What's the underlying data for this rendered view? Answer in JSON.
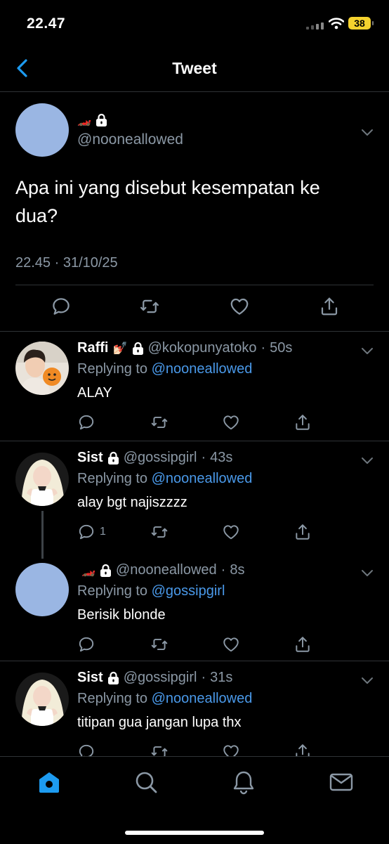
{
  "status": {
    "time": "22.47",
    "battery": "38"
  },
  "nav": {
    "title": "Tweet"
  },
  "main_tweet": {
    "handle": "@nooneallowed",
    "text": "Apa ini yang disebut kesempatan ke dua?",
    "timestamp": "22.45 · 31/10/25"
  },
  "replies": [
    {
      "name": "Raffi",
      "handle": "@kokopunyatoko",
      "time": "50s",
      "replying_prefix": "Replying to ",
      "replying_to": "@nooneallowed",
      "text": "ALAY",
      "reply_count": ""
    },
    {
      "name": "Sist",
      "handle": "@gossipgirl",
      "time": "43s",
      "replying_prefix": "Replying to ",
      "replying_to": "@nooneallowed",
      "text": "alay bgt najiszzzz",
      "reply_count": "1"
    },
    {
      "name": "",
      "handle": "@nooneallowed",
      "time": "8s",
      "replying_prefix": "Replying to ",
      "replying_to": "@gossipgirl",
      "text": "Berisik blonde",
      "reply_count": ""
    },
    {
      "name": "Sist",
      "handle": "@gossipgirl",
      "time": "31s",
      "replying_prefix": "Replying to ",
      "replying_to": "@nooneallowed",
      "text": "titipan gua jangan lupa thx",
      "reply_count": ""
    }
  ],
  "colors": {
    "accent": "#1d9bf0",
    "mention": "#4a99e9",
    "muted": "#8b98a5",
    "divider": "#2f3336",
    "battery": "#f5d22e"
  },
  "icons": [
    "back-chevron-icon",
    "lock-icon",
    "chevron-down-icon",
    "reply-icon",
    "retweet-icon",
    "like-icon",
    "share-icon",
    "home-icon",
    "search-icon",
    "bell-icon",
    "mail-icon"
  ]
}
